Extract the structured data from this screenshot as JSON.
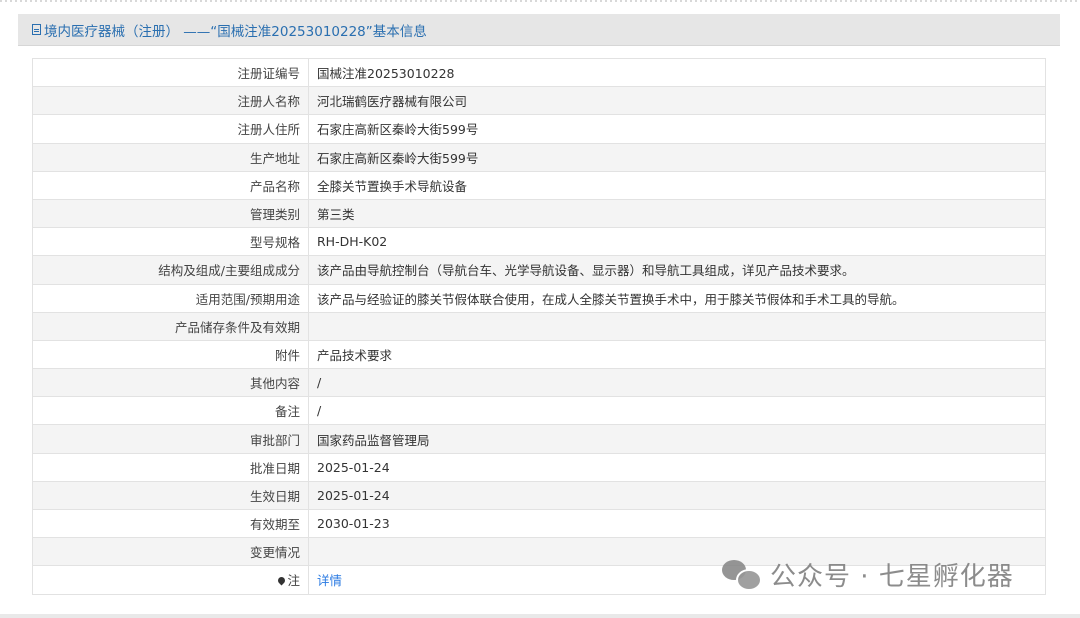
{
  "header": {
    "title": "境内医疗器械（注册） ——“国械注准20253010228”基本信息"
  },
  "rows": [
    {
      "label": "注册证编号",
      "value": "国械注准20253010228"
    },
    {
      "label": "注册人名称",
      "value": "河北瑞鹤医疗器械有限公司"
    },
    {
      "label": "注册人住所",
      "value": "石家庄高新区秦岭大街599号"
    },
    {
      "label": "生产地址",
      "value": "石家庄高新区秦岭大街599号"
    },
    {
      "label": "产品名称",
      "value": "全膝关节置换手术导航设备"
    },
    {
      "label": "管理类别",
      "value": "第三类"
    },
    {
      "label": "型号规格",
      "value": "RH-DH-K02"
    },
    {
      "label": "结构及组成/主要组成成分",
      "value": "该产品由导航控制台（导航台车、光学导航设备、显示器）和导航工具组成，详见产品技术要求。"
    },
    {
      "label": "适用范围/预期用途",
      "value": "该产品与经验证的膝关节假体联合使用，在成人全膝关节置换手术中，用于膝关节假体和手术工具的导航。"
    },
    {
      "label": "产品储存条件及有效期",
      "value": ""
    },
    {
      "label": "附件",
      "value": "产品技术要求"
    },
    {
      "label": "其他内容",
      "value": "/"
    },
    {
      "label": "备注",
      "value": "/"
    },
    {
      "label": "审批部门",
      "value": "国家药品监督管理局"
    },
    {
      "label": "批准日期",
      "value": "2025-01-24"
    },
    {
      "label": "生效日期",
      "value": "2025-01-24"
    },
    {
      "label": "有效期至",
      "value": "2030-01-23"
    },
    {
      "label": "变更情况",
      "value": ""
    }
  ],
  "note_row": {
    "label": "注",
    "link": "详情"
  },
  "watermark": {
    "text": "公众号 · 七星孵化器"
  }
}
